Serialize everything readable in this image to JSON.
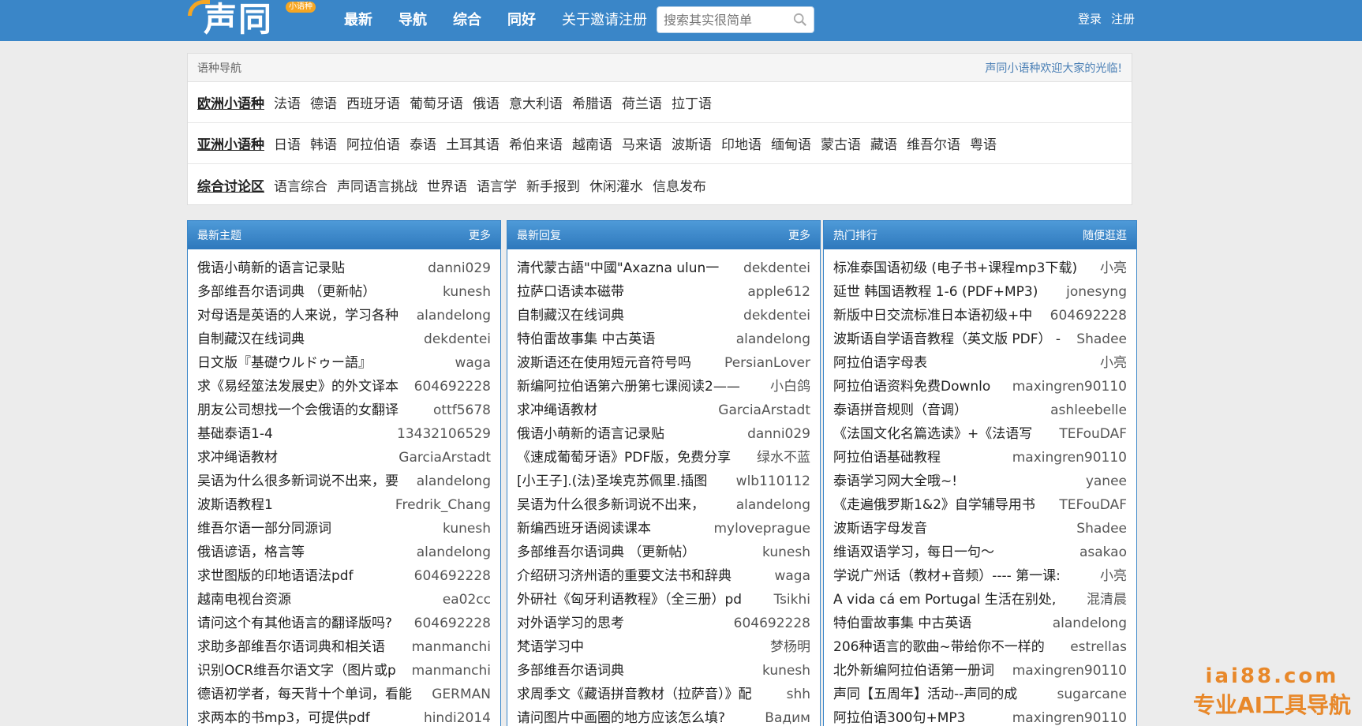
{
  "header": {
    "logo_text": "声同",
    "logo_badge": "小语种",
    "nav": [
      "最新",
      "导航",
      "综合",
      "同好",
      "关于邀请注册"
    ],
    "search_placeholder": "搜索其实很简单",
    "login": "登录",
    "register": "注册"
  },
  "lang_nav": {
    "title": "语种导航",
    "welcome": "声同小语种欢迎大家的光临!",
    "rows": [
      {
        "category": "欧洲小语种",
        "links": [
          "法语",
          "德语",
          "西班牙语",
          "葡萄牙语",
          "俄语",
          "意大利语",
          "希腊语",
          "荷兰语",
          "拉丁语"
        ]
      },
      {
        "category": "亚洲小语种",
        "links": [
          "日语",
          "韩语",
          "阿拉伯语",
          "泰语",
          "土耳其语",
          "希伯来语",
          "越南语",
          "马来语",
          "波斯语",
          "印地语",
          "缅甸语",
          "蒙古语",
          "藏语",
          "维吾尔语",
          "粤语"
        ]
      },
      {
        "category": "综合讨论区",
        "links": [
          "语言综合",
          "声同语言挑战",
          "世界语",
          "语言学",
          "新手报到",
          "休闲灌水",
          "信息发布"
        ]
      }
    ]
  },
  "columns": [
    {
      "title": "最新主题",
      "more": "更多",
      "items": [
        {
          "t": "俄语小萌新的语言记录贴",
          "a": "danni029"
        },
        {
          "t": "多部维吾尔语词典 （更新帖）",
          "a": "kunesh"
        },
        {
          "t": "对母语是英语的人来说，学习各种",
          "a": "alandelong"
        },
        {
          "t": "自制藏汉在线词典",
          "a": "dekdentei"
        },
        {
          "t": "日文版『基礎ウルドゥー語』",
          "a": "waga"
        },
        {
          "t": "求《易经筮法发展史》的外文译本",
          "a": "604692228"
        },
        {
          "t": "朋友公司想找一个会俄语的女翻译",
          "a": "ottf5678"
        },
        {
          "t": "基础泰语1-4",
          "a": "13432106529"
        },
        {
          "t": "求冲绳语教材",
          "a": "GarciaArstadt"
        },
        {
          "t": "吴语为什么很多新词说不出来，要",
          "a": "alandelong"
        },
        {
          "t": "波斯语教程1",
          "a": "Fredrik_Chang"
        },
        {
          "t": "维吾尔语一部分同源词",
          "a": "kunesh"
        },
        {
          "t": "俄语谚语，格言等",
          "a": "alandelong"
        },
        {
          "t": "求世图版的印地语语法pdf",
          "a": "604692228"
        },
        {
          "t": "越南电视台资源",
          "a": "ea02cc"
        },
        {
          "t": "请问这个有其他语言的翻译版吗?",
          "a": "604692228"
        },
        {
          "t": "求助多部维吾尔语词典和相关语",
          "a": "manmanchi"
        },
        {
          "t": "识别OCR维吾尔语文字（图片或p",
          "a": "manmanchi"
        },
        {
          "t": "德语初学者，每天背十个单词，看能",
          "a": "GERMAN"
        },
        {
          "t": "求两本的书mp3，可提供pdf",
          "a": "hindi2014"
        }
      ]
    },
    {
      "title": "最新回复",
      "more": "更多",
      "items": [
        {
          "t": "清代蒙古語\"中國\"Axazna ulun一",
          "a": "dekdentei"
        },
        {
          "t": "拉萨口语读本磁带",
          "a": "apple612"
        },
        {
          "t": "自制藏汉在线词典",
          "a": "dekdentei"
        },
        {
          "t": "特伯雷故事集 中古英语",
          "a": "alandelong"
        },
        {
          "t": "波斯语还在使用短元音符号吗",
          "a": "PersianLover"
        },
        {
          "t": "新编阿拉伯语第六册第七课阅读2——",
          "a": "小白鸽"
        },
        {
          "t": "求冲绳语教材",
          "a": "GarciaArstadt"
        },
        {
          "t": "俄语小萌新的语言记录贴",
          "a": "danni029"
        },
        {
          "t": "《速成葡萄牙语》PDF版，免费分享",
          "a": "绿水不蓝"
        },
        {
          "t": "[小王子].(法)圣埃克苏佩里.插图",
          "a": "wlb110112"
        },
        {
          "t": "吴语为什么很多新词说不出来，",
          "a": "alandelong"
        },
        {
          "t": "新编西班牙语阅读课本",
          "a": "myloveprague"
        },
        {
          "t": "多部维吾尔语词典 （更新帖）",
          "a": "kunesh"
        },
        {
          "t": "介绍研习济州语的重要文法书和辞典",
          "a": "waga"
        },
        {
          "t": "外研社《匈牙利语教程》（全三册）pd",
          "a": "Tsikhi"
        },
        {
          "t": "对外语学习的思考",
          "a": "604692228"
        },
        {
          "t": "梵语学习中",
          "a": "梦杨明"
        },
        {
          "t": "多部维吾尔语词典",
          "a": "kunesh"
        },
        {
          "t": "求周季文《藏语拼音教材（拉萨音）》配",
          "a": "shh"
        },
        {
          "t": "请问图片中画圈的地方应该怎么填?",
          "a": "Вадим"
        }
      ]
    },
    {
      "title": "热门排行",
      "more": "随便逛逛",
      "items": [
        {
          "t": "标准泰国语初级 (电子书+课程mp3下载)",
          "a": "小亮"
        },
        {
          "t": "延世 韩国语教程 1-6 (PDF+MP3)",
          "a": "jonesyng"
        },
        {
          "t": "新版中日交流标准日本语初级+中",
          "a": "604692228"
        },
        {
          "t": "波斯语自学语音教程（英文版 PDF） -",
          "a": "Shadee"
        },
        {
          "t": "阿拉伯语字母表",
          "a": "小亮"
        },
        {
          "t": "阿拉伯语资料免费Downlo",
          "a": "maxingren90110"
        },
        {
          "t": "泰语拼音规则（音调）",
          "a": "ashleebelle"
        },
        {
          "t": "《法国文化名篇选读》+《法语写",
          "a": "TEFouDAF"
        },
        {
          "t": "阿拉伯语基础教程",
          "a": "maxingren90110"
        },
        {
          "t": "泰语学习网大全哦~!",
          "a": "yanee"
        },
        {
          "t": "《走遍俄罗斯1&2》自学辅导用书",
          "a": "TEFouDAF"
        },
        {
          "t": "波斯语字母发音",
          "a": "Shadee"
        },
        {
          "t": "维语双语学习，每日一句～",
          "a": "asakao"
        },
        {
          "t": "学说广州话（教材+音频）---- 第一课:",
          "a": "小亮"
        },
        {
          "t": "A vida cá em Portugal 生活在别处,",
          "a": "混清晨"
        },
        {
          "t": "特伯雷故事集 中古英语",
          "a": "alandelong"
        },
        {
          "t": "206种语言的歌曲~带给你不一样的",
          "a": "estrellas"
        },
        {
          "t": "北外新编阿拉伯语第一册词",
          "a": "maxingren90110"
        },
        {
          "t": "声同【五周年】活动--声同的成",
          "a": "sugarcane"
        },
        {
          "t": "阿拉伯语300句+MP3",
          "a": "maxingren90110"
        }
      ]
    }
  ],
  "watermark": {
    "line1": "iai88.com",
    "line2": "专业AI工具导航"
  },
  "colors": {
    "header_bg": "#3a86c8",
    "watermark": "#e8882a"
  }
}
